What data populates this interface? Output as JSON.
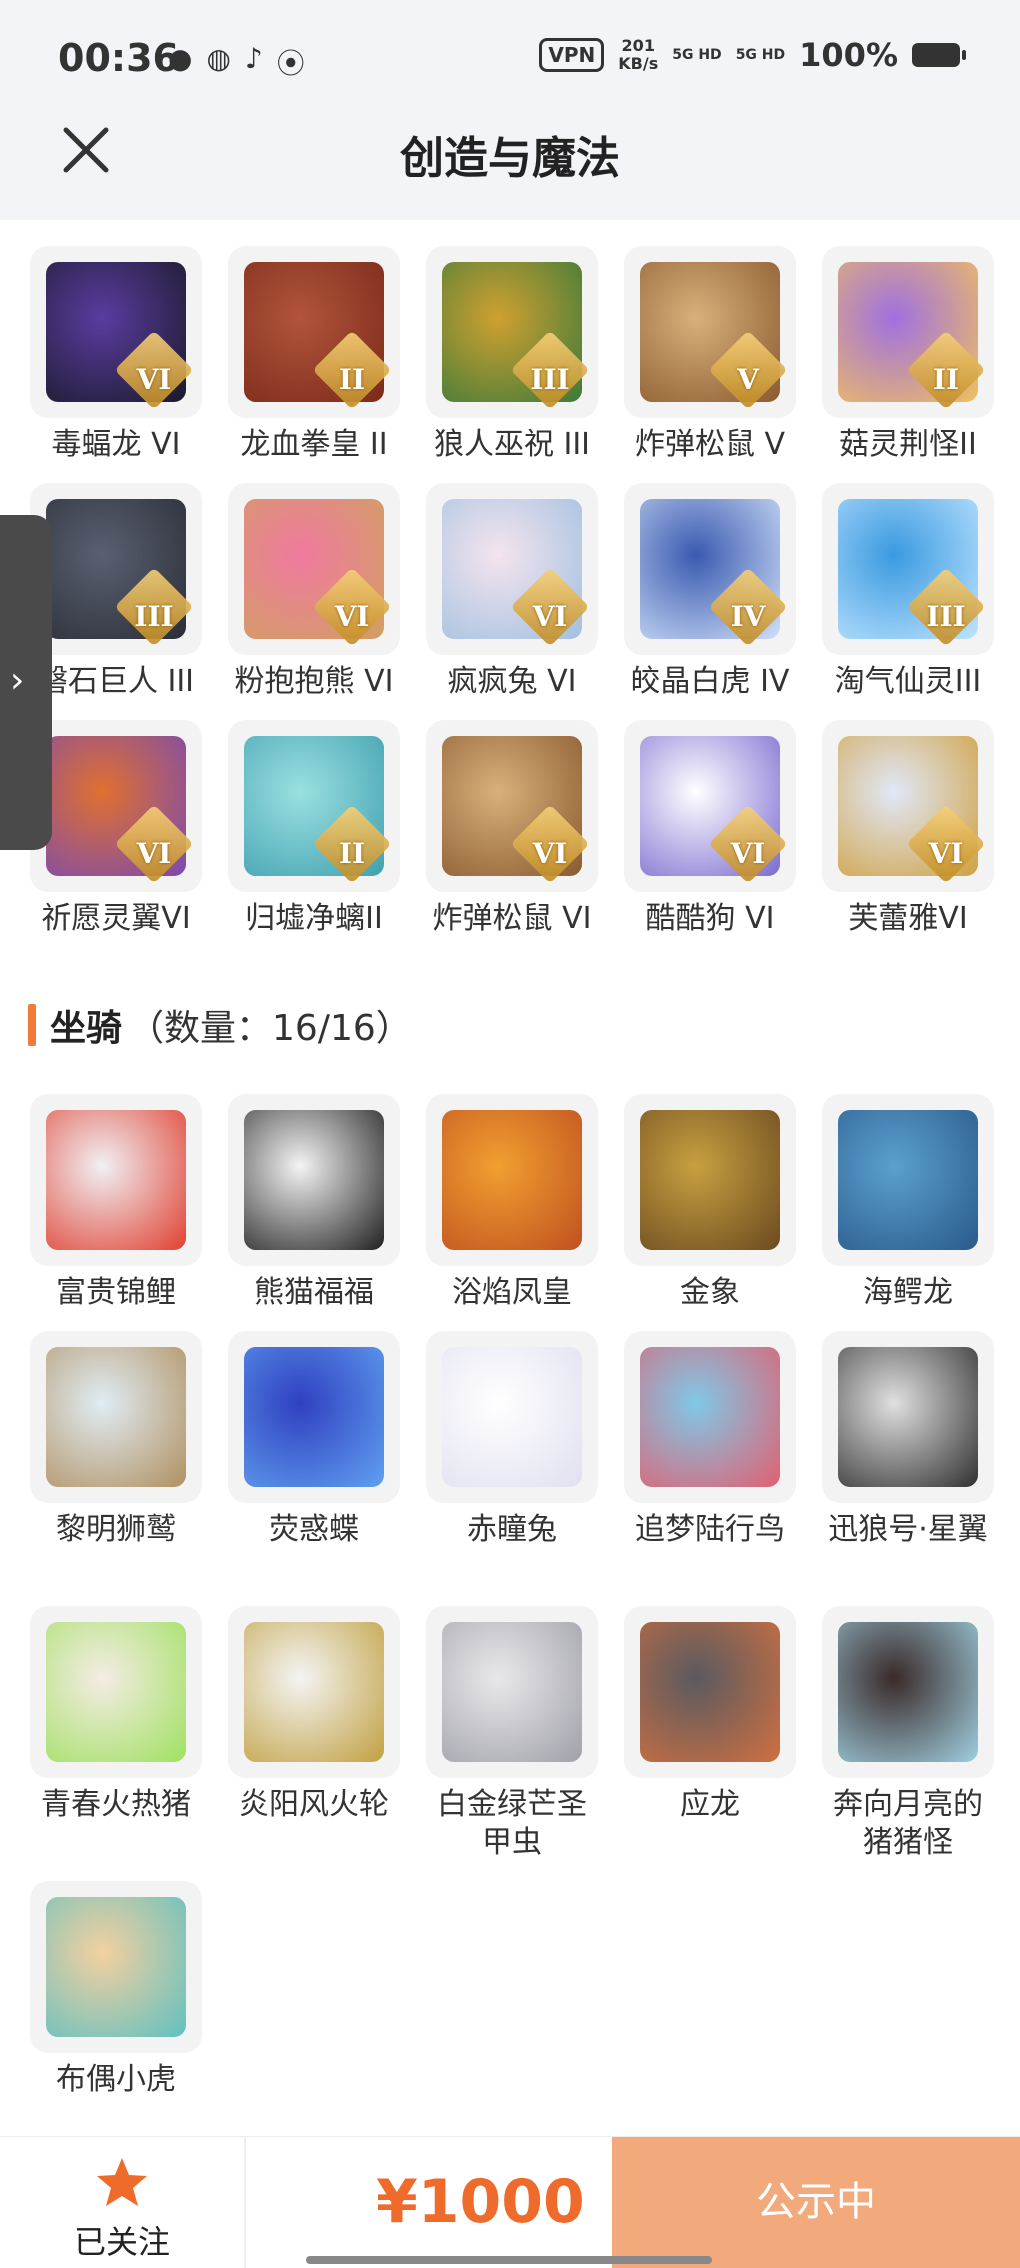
{
  "status_bar": {
    "time": "00:36",
    "vpn": "VPN",
    "speed_top": "201",
    "speed_bottom": "KB/s",
    "sig1": "5G HD",
    "sig2": "5G HD",
    "battery": "100%"
  },
  "header": {
    "title": "创造与魔法"
  },
  "pets": [
    {
      "name": "毒蝠龙 VI",
      "badge": "VI",
      "colors": [
        "#5a3ca0",
        "#1a1a2a"
      ]
    },
    {
      "name": "龙血拳皇 II",
      "badge": "II",
      "colors": [
        "#b2543a",
        "#7a2a1a"
      ]
    },
    {
      "name": "狼人巫祝 III",
      "badge": "III",
      "colors": [
        "#d0a030",
        "#3a7a3a"
      ]
    },
    {
      "name": "炸弹松鼠 V",
      "badge": "V",
      "colors": [
        "#d8b07a",
        "#8a5a30"
      ]
    },
    {
      "name": "菇灵荆怪II",
      "badge": "II",
      "colors": [
        "#a070e0",
        "#f0c060"
      ]
    },
    {
      "name": "磐石巨人 III",
      "badge": "III",
      "colors": [
        "#5a6070",
        "#2a2e38"
      ]
    },
    {
      "name": "粉抱抱熊 VI",
      "badge": "VI",
      "colors": [
        "#f07aa0",
        "#d0a060"
      ]
    },
    {
      "name": "疯疯兔 VI",
      "badge": "VI",
      "colors": [
        "#f4e4ee",
        "#a0c0e0"
      ]
    },
    {
      "name": "皎晶白虎 IV",
      "badge": "IV",
      "colors": [
        "#3a5ab0",
        "#d0e0f8"
      ]
    },
    {
      "name": "淘气仙灵III",
      "badge": "III",
      "colors": [
        "#3a9ae0",
        "#c0e4ff"
      ]
    },
    {
      "name": "祈愿灵翼VI",
      "badge": "VI",
      "colors": [
        "#e07030",
        "#7a4ab0"
      ]
    },
    {
      "name": "归墟净螭II",
      "badge": "II",
      "colors": [
        "#9ae0e0",
        "#40a0b0"
      ]
    },
    {
      "name": "炸弹松鼠 VI",
      "badge": "VI",
      "colors": [
        "#d8b07a",
        "#8a5a30"
      ]
    },
    {
      "name": "酷酷狗 VI",
      "badge": "VI",
      "colors": [
        "#ffffff",
        "#7a6ad0"
      ]
    },
    {
      "name": "芙蕾雅VI",
      "badge": "VI",
      "colors": [
        "#e0e8f8",
        "#d0a040"
      ]
    }
  ],
  "mounts_section": {
    "label": "坐骑",
    "count": "（数量：16/16）"
  },
  "mounts": [
    {
      "name": "富贵锦鲤",
      "colors": [
        "#f0f0f4",
        "#e04030"
      ]
    },
    {
      "name": "熊猫福福",
      "colors": [
        "#f4f4f4",
        "#202020"
      ]
    },
    {
      "name": "浴焰凤皇",
      "colors": [
        "#f0a030",
        "#c05020"
      ]
    },
    {
      "name": "金象",
      "colors": [
        "#c8a040",
        "#6a4a20"
      ]
    },
    {
      "name": "海鳄龙",
      "colors": [
        "#5aa0d0",
        "#2a5a8a"
      ]
    },
    {
      "name": "黎明狮鹫",
      "colors": [
        "#e0ecf4",
        "#b09060"
      ]
    },
    {
      "name": "荧惑蝶",
      "colors": [
        "#3040c0",
        "#60a0f0"
      ]
    },
    {
      "name": "赤瞳兔",
      "colors": [
        "#ffffff",
        "#e0e0f0"
      ]
    },
    {
      "name": "追梦陆行鸟",
      "colors": [
        "#80c8e8",
        "#e06070"
      ]
    },
    {
      "name": "迅狼号·星翼",
      "colors": [
        "#e0e0e0",
        "#303030"
      ]
    },
    {
      "name": "青春火热猪",
      "colors": [
        "#f4ece4",
        "#a0e060"
      ]
    },
    {
      "name": "炎阳风火轮",
      "colors": [
        "#f4f4f4",
        "#c0a040"
      ]
    },
    {
      "name": "白金绿芒圣甲虫",
      "colors": [
        "#e8e8ec",
        "#a0a0a8"
      ]
    },
    {
      "name": "应龙",
      "colors": [
        "#5a5a60",
        "#d07040"
      ]
    },
    {
      "name": "奔向月亮的猪猪怪",
      "colors": [
        "#3a2a2a",
        "#a0d0e0"
      ]
    },
    {
      "name": "布偶小虎",
      "colors": [
        "#f4d0a0",
        "#60c0c0"
      ]
    }
  ],
  "bottom_bar": {
    "follow_label": "已关注",
    "price": "¥1000",
    "publish_label": "公示中"
  },
  "icons": {
    "close": "close-icon",
    "star": "star-icon",
    "chevron": "chevron-right-icon"
  },
  "colors": {
    "accent": "#ef6b2c",
    "publish_bg": "#f2a97b",
    "section_bar": "#f07a3a"
  }
}
